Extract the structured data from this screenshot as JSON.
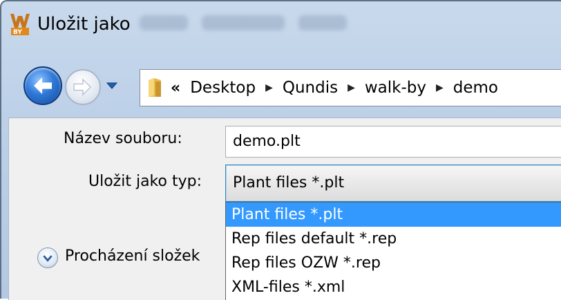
{
  "window": {
    "title": "Uložit jako",
    "app_icon_letters": "WBY"
  },
  "navigation": {
    "overflow_chevron": "«",
    "breadcrumbs": [
      {
        "label": "Desktop"
      },
      {
        "label": "Qundis"
      },
      {
        "label": "walk-by"
      },
      {
        "label": "demo"
      }
    ],
    "separator_glyph": "▶"
  },
  "form": {
    "filename_label": "Název souboru:",
    "filename_value": "demo.plt",
    "filetype_label": "Uložit jako typ:",
    "filetype_selected": "Plant files *.plt",
    "filetype_options": [
      {
        "label": "Plant files *.plt",
        "selected": true
      },
      {
        "label": "Rep files default *.rep",
        "selected": false
      },
      {
        "label": "Rep files OZW *.rep",
        "selected": false
      },
      {
        "label": "XML-files *.xml",
        "selected": false
      }
    ]
  },
  "footer": {
    "browse_folders_label": "Procházení složek"
  },
  "colors": {
    "selection": "#3399ff",
    "titlebar": "#c9d9ec",
    "panel": "#f0f0f0"
  }
}
